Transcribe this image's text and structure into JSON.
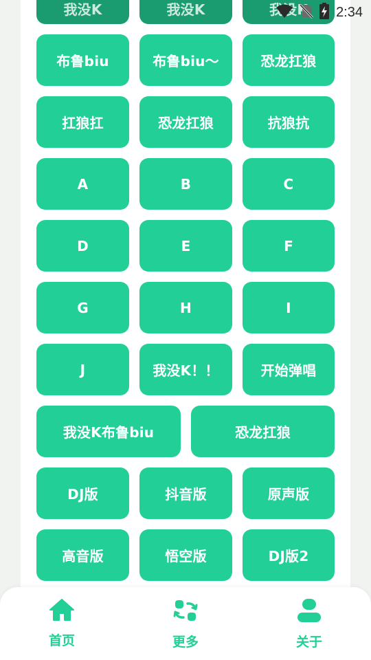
{
  "status_bar": {
    "time": "2:34"
  },
  "colors": {
    "accent": "#22cf96",
    "background": "#f1f3f1",
    "card": "#ffffff"
  },
  "buttons": {
    "row0": [
      "我没K",
      "我没K",
      "我没K"
    ],
    "row1": [
      "布鲁biu",
      "布鲁biu〜",
      "恐龙扛狼"
    ],
    "row2": [
      "扛狼扛",
      "恐龙扛狼",
      "抗狼抗"
    ],
    "row3": [
      "A",
      "B",
      "C"
    ],
    "row4": [
      "D",
      "E",
      "F"
    ],
    "row5": [
      "G",
      "H",
      "I"
    ],
    "row6": [
      "J",
      "我没K！！",
      "开始弹唱"
    ],
    "row7": [
      "我没K布鲁biu",
      "恐龙扛狼"
    ],
    "row8": [
      "DJ版",
      "抖音版",
      "原声版"
    ],
    "row9": [
      "高音版",
      "悟空版",
      "DJ版2"
    ]
  },
  "nav": {
    "home": {
      "label": "首页",
      "icon": "home-icon"
    },
    "more": {
      "label": "更多",
      "icon": "switch-icon"
    },
    "about": {
      "label": "关于",
      "icon": "user-icon"
    }
  }
}
